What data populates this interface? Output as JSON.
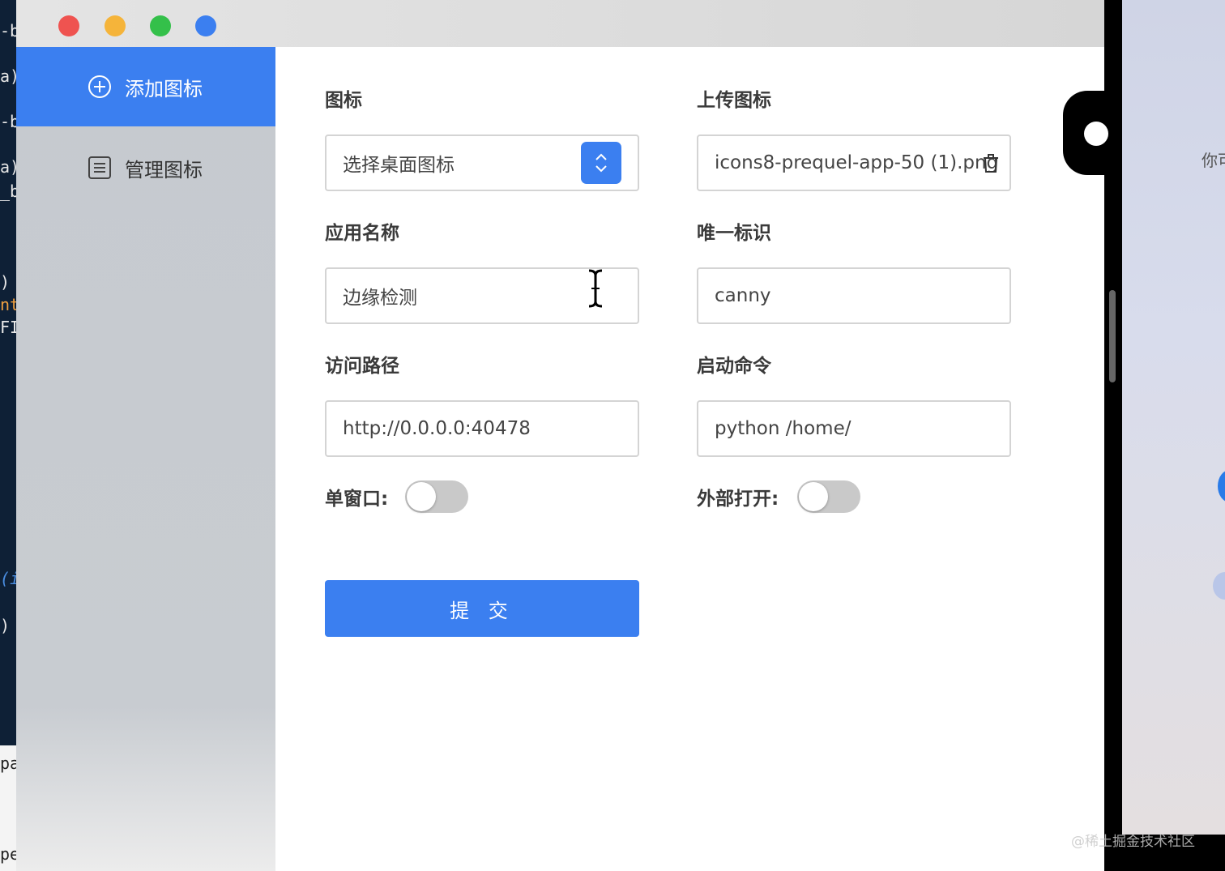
{
  "editor": {
    "lines_dark": [
      "-b]",
      "a)]",
      "-b]",
      "a)]",
      "_bg",
      ")",
      "nt(",
      "FI",
      "(i",
      ")"
    ],
    "lines_light": [
      "pa",
      "pe"
    ]
  },
  "window": {
    "traffic_colors": [
      "#ef5350",
      "#f5b43a",
      "#34c04a",
      "#3b7ff0"
    ]
  },
  "sidebar": {
    "items": [
      {
        "label": "添加图标",
        "icon": "plus-circle-icon",
        "active": true
      },
      {
        "label": "管理图标",
        "icon": "list-icon",
        "active": false
      }
    ]
  },
  "form": {
    "icon": {
      "label": "图标",
      "value": "选择桌面图标"
    },
    "upload": {
      "label": "上传图标",
      "value": "icons8-prequel-app-50 (1).png"
    },
    "app_name": {
      "label": "应用名称",
      "value": "边缘检测"
    },
    "unique_id": {
      "label": "唯一标识",
      "value": "canny"
    },
    "path": {
      "label": "访问路径",
      "value": "http://0.0.0.0:40478"
    },
    "command": {
      "label": "启动命令",
      "value": "python /home/"
    },
    "single_window": {
      "label": "单窗口:",
      "on": false
    },
    "external_open": {
      "label": "外部打开:",
      "on": false
    },
    "submit_label": "提 交"
  },
  "right_panel": {
    "partial_text": "你可"
  },
  "watermark": "@稀土掘金技术社区",
  "colors": {
    "accent": "#3b7ff0",
    "toggle_off": "#c9c9c9"
  }
}
